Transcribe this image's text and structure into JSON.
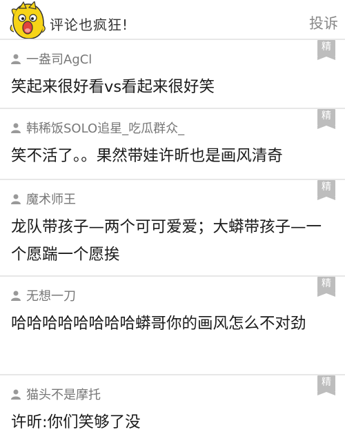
{
  "header": {
    "title": "评论也疯狂!",
    "action_label": "投诉"
  },
  "badge_label": "精",
  "comments": [
    {
      "username": "一盎司AgCl",
      "text": "笑起来很好看vs看起来很好笑"
    },
    {
      "username": "韩稀饭SOLO追星_吃瓜群众_",
      "text": "笑不活了。。果然带娃许昕也是画风清奇"
    },
    {
      "username": "魔术师王",
      "text": "龙队带孩子—两个可可爱爱；大蟒带孩子—一个愿踹一个愿挨"
    },
    {
      "username": "无想一刀",
      "text": "哈哈哈哈哈哈哈哈蟒哥你的画风怎么不对劲"
    },
    {
      "username": "猫头不是摩托",
      "text": "许昕:你们笑够了没"
    }
  ],
  "colors": {
    "badge": "#bdbdbd",
    "mascot_yellow": "#f7d417",
    "divider": "#e7e7e7"
  }
}
